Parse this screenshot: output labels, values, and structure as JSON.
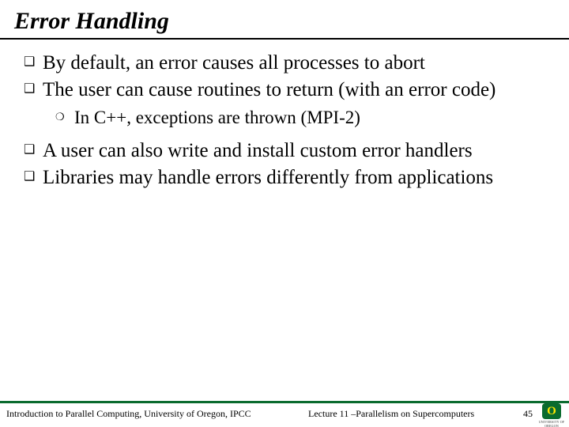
{
  "title": "Error Handling",
  "bullets": {
    "b1": "By default, an error causes all processes to abort",
    "b2": "The user can cause routines to return (with an error code)",
    "b2_1": "In C++, exceptions are thrown (MPI-2)",
    "b3": "A user can also write and install custom error handlers",
    "b4": "Libraries may handle errors differently from applications"
  },
  "glyphs": {
    "square": "❑",
    "circle": "❍"
  },
  "footer": {
    "left": "Introduction to Parallel Computing, University of Oregon, IPCC",
    "center": "Lecture 11 –Parallelism on Supercomputers",
    "pagenum": "45",
    "logo_o": "O",
    "logo_text": "UNIVERSITY OF OREGON"
  }
}
